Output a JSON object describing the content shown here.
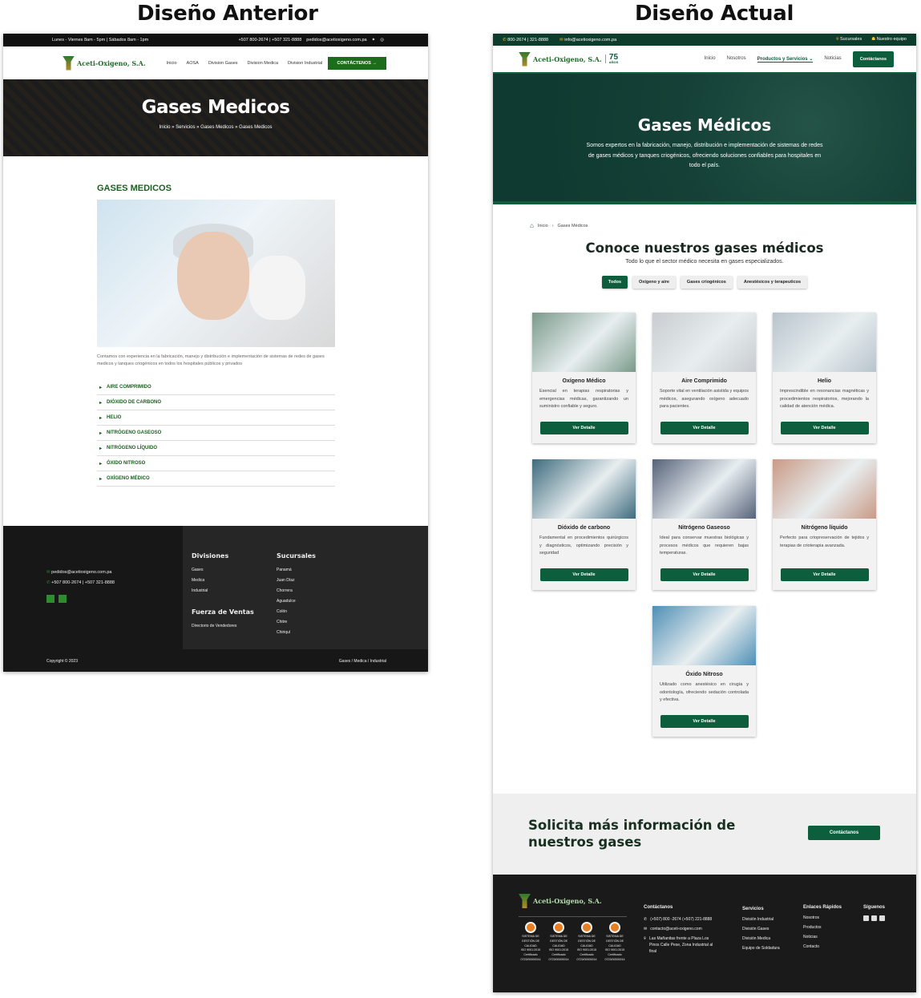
{
  "headings": {
    "left": "Diseño Anterior",
    "right": "Diseño Actual"
  },
  "old": {
    "topbar": {
      "hours": "Lunes - Viernes 8am - 5pm | Sábados 8am - 1pm",
      "phone": "+507 800-2674 | +507 321-8888",
      "email": "pedidos@acetioxigeno.com.pa"
    },
    "logo": "Aceti-Oxigeno, S.A.",
    "nav": [
      "Inicio",
      "AOSA",
      "Division Gases",
      "Division Medica",
      "Division Industrial"
    ],
    "cta": "CONTÁCTENOS →",
    "hero": {
      "title": "Gases Medicos",
      "crumb": "Inicio » Servicios » Gases Medicos » Gases Medicos"
    },
    "section_title": "GASES MEDICOS",
    "description": "Contamos con experiencia en la fabricación, manejo y distribución e implementación de sistemas de redes de gases medicos y tanques criogénicos en todos los hospitales públicos y privados",
    "accordion": [
      "AIRE COMPRIMIDO",
      "DIÓXIDO DE CARBONO",
      "HELIO",
      "NITRÓGENO GASEOSO",
      "NITRÓGENO LÍQUIDO",
      "ÓXIDO NITROSO",
      "OXÍGENO MÉDICO"
    ],
    "footer": {
      "email": "pedidos@acetioxigeno.com.pa",
      "phone": "+507 800-2674 | +507 321-8888",
      "divisiones_title": "Divisiones",
      "divisiones": [
        "Gases",
        "Medica",
        "Industrial"
      ],
      "ventas_title": "Fuerza de Ventas",
      "ventas": "Directorio de Vendedores",
      "sucursales_title": "Sucursales",
      "sucursales": [
        "Panamá",
        "Juan Díaz",
        "Chorrera",
        "Aguadulce",
        "Colón",
        "Chitre",
        "Chiriquí"
      ],
      "copyright": "Copyright © 2023",
      "links": "Gases / Medica / Industrial"
    }
  },
  "new": {
    "topbar": {
      "phone": "800-2674 | 321-8888",
      "email": "info@acetioxigeno.com.pa",
      "sucursales": "Sucursales",
      "equipo": "Nuestro equipo"
    },
    "logo": "Aceti-Oxigeno, S.A.",
    "anio_num": "75",
    "anio_txt": "AÑOS",
    "nav": [
      "Inicio",
      "Nosotros",
      "Productos y Servicios ⌄",
      "Noticias"
    ],
    "cta": "Contáctanos",
    "hero": {
      "title": "Gases Médicos",
      "text": "Somos expertos en la fabricación, manejo, distribución e implementación de sistemas de redes de gases médicos y tanques criogénicos, ofreciendo soluciones confiables para hospitales en todo el país."
    },
    "crumb": {
      "home": "Inicio",
      "current": "Gases Médicos"
    },
    "title": "Conoce nuestros gases médicos",
    "subtitle": "Todo lo que el sector médico necesita en gases especializados.",
    "filters": [
      "Todos",
      "Oxígeno y aire",
      "Gases criogénicos",
      "Anestésicos y terapeuticos"
    ],
    "button": "Ver Detalle",
    "cards": [
      {
        "name": "Oxígeno Médico",
        "text": "Esencial en terapias respiratorias y emergencias médicas, garantizando un suministro confiable y seguro.",
        "color": "#7a9a8a"
      },
      {
        "name": "Aire Comprimido",
        "text": "Soporte vital en ventilación asistida y equipos médicos, asegurando oxígeno adecuado para pacientes.",
        "color": "#c8ccd0"
      },
      {
        "name": "Helio",
        "text": "Imprescindible en resonancias magnéticas y procedimientos respiratorios, mejorando la calidad de atención médica.",
        "color": "#b8c4cc"
      },
      {
        "name": "Dióxido de carbono",
        "text": "Fundamental en procedimientos quirúrgicos y diagnósticos, optimizando precisión y seguridad",
        "color": "#3e6b7e"
      },
      {
        "name": "Nitrógeno Gaseoso",
        "text": "Ideal para conservar muestras biológicas y procesos médicos que requieren bajas temperaturas.",
        "color": "#56627a"
      },
      {
        "name": "Nitrógeno líquido",
        "text": "Perfecto para criopreservación de tejidos y terapias de crioterapia avanzada.",
        "color": "#c99a86"
      },
      {
        "name": "Óxido Nitroso",
        "text": "Utilizado como anestésico en cirugía y odontología, ofreciendo sedación controlada y efectiva.",
        "color": "#4f8fb5"
      }
    ],
    "cta_band": {
      "title": "Solicita  más información de nuestros gases",
      "button": "Contáctanos"
    },
    "footer": {
      "contact_title": "Contáctanos",
      "phone": "(+507) 800 -2674 (+507) 221-8888",
      "email": "contacto@aceti-oxigeno.com",
      "address": "Las Mañanitas frente a Plaza Los Pinos Calle Pese, Zona Industrial al final",
      "servicios_title": "Servicios",
      "servicios": [
        "División Industrial",
        "División Gases",
        "División Medica",
        "Equipo de Soldadura"
      ],
      "enlaces_title": "Enlaces Rápidos",
      "enlaces": [
        "Nosotros",
        "Productos",
        "Noticias",
        "Contacto"
      ],
      "siguenos": "Síguenos",
      "certs": [
        {
          "t": "SISTEMA DE GESTIÓN DE CALIDAD",
          "iso": "ISO 9001:2015",
          "c": "Certificado 0723/00000014"
        },
        {
          "t": "SISTEMA DE GESTIÓN DE CALIDAD",
          "iso": "ISO 9001:2015",
          "c": "Certificado 0723/00000014"
        },
        {
          "t": "SISTEMA DE GESTIÓN DE CALIDAD",
          "iso": "ISO 9001:2015",
          "c": "Certificado 0723/00000014"
        },
        {
          "t": "SISTEMA DE GESTIÓN DE CALIDAD",
          "iso": "ISO 9001:2015",
          "c": "Certificado 0723/00000014"
        }
      ]
    }
  }
}
